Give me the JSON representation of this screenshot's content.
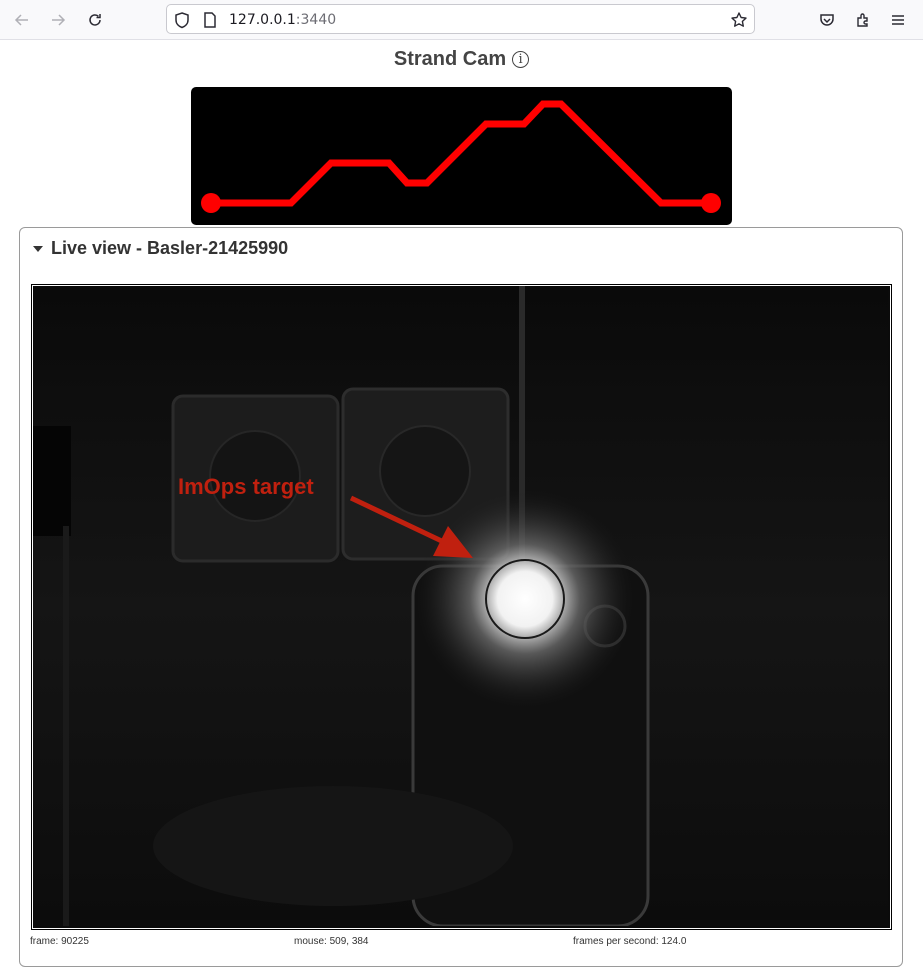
{
  "browser": {
    "url_host": "127.0.0.1",
    "url_port": ":3440"
  },
  "page": {
    "title": "Strand Cam",
    "info_symbol": "i"
  },
  "panel": {
    "summary": "Live view - Basler-21425990",
    "annotation_label": "ImOps target",
    "status": {
      "frame": "frame: 90225",
      "mouse": "mouse: 509, 384",
      "fps": "frames per second: 124.0"
    }
  },
  "icons": [
    "back-arrow-icon",
    "forward-arrow-icon",
    "reload-icon",
    "shield-icon",
    "page-icon",
    "bookmark-star-icon",
    "pocket-icon",
    "extensions-icon",
    "menu-icon",
    "info-icon",
    "caret-down-icon"
  ],
  "colors": {
    "logo_line": "#ff0000",
    "annotation": "#c0200f",
    "logo_bg": "#000000"
  }
}
